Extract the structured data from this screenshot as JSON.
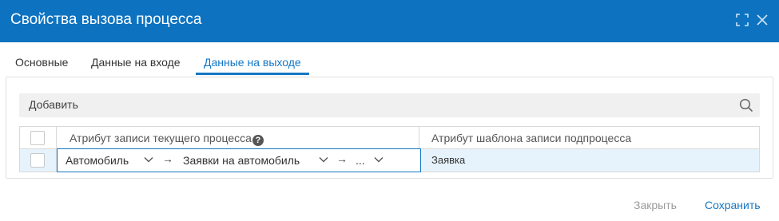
{
  "dialog": {
    "title": "Свойства вызова процесса",
    "colors": {
      "header": "#0d73c1",
      "accent": "#1577c4",
      "row_selected": "#e6f3fc"
    },
    "window_icons": [
      "maximize-icon",
      "close-icon"
    ]
  },
  "tabs": [
    {
      "label": "Основные",
      "active": false
    },
    {
      "label": "Данные на входе",
      "active": false
    },
    {
      "label": "Данные на выходе",
      "active": true
    }
  ],
  "toolbar": {
    "add_label": "Добавить",
    "search_icon": "search-icon"
  },
  "table": {
    "columns": [
      "Атрибут записи текущего процесса",
      "Атрибут шаблона записи подпроцесса"
    ],
    "rows": [
      {
        "path": [
          "Автомобиль",
          "Заявки на автомобиль",
          "..."
        ],
        "target": "Заявка"
      }
    ]
  },
  "footer": {
    "close_label": "Закрыть",
    "save_label": "Сохранить"
  }
}
